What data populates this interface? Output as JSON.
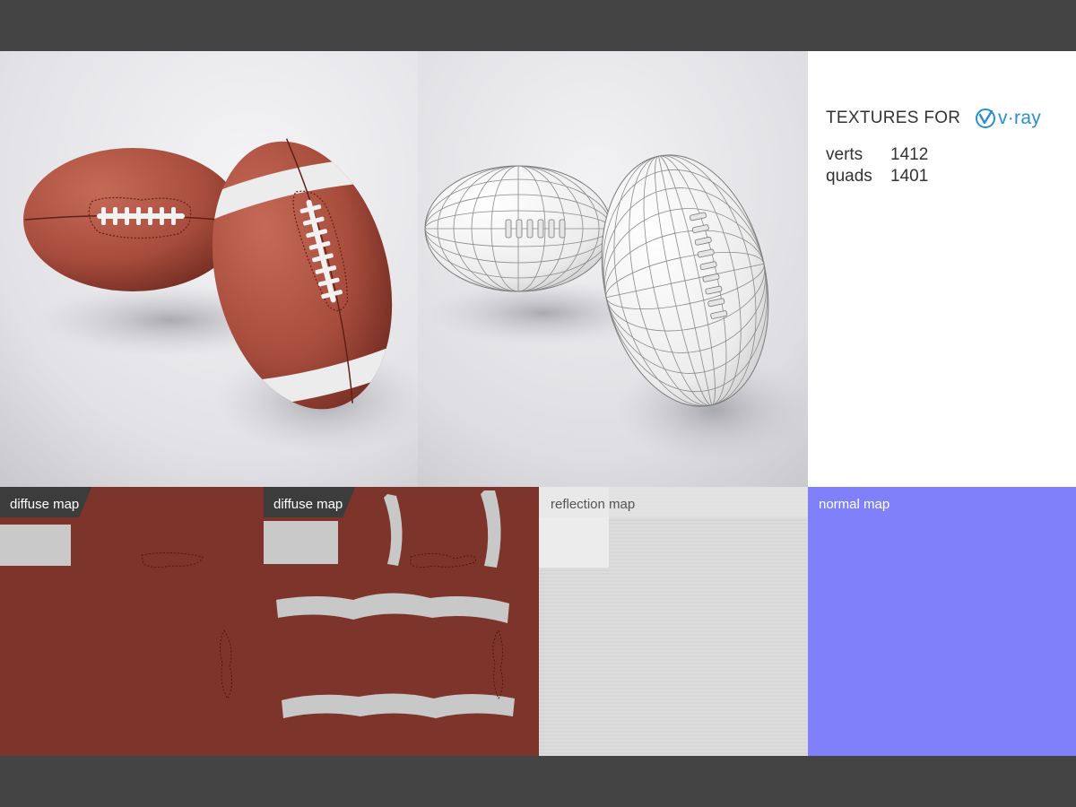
{
  "info": {
    "title": "TEXTURES FOR",
    "logo_text": "v·ray",
    "stats": [
      {
        "key": "verts",
        "value": "1412"
      },
      {
        "key": "quads",
        "value": "1401"
      }
    ]
  },
  "maps": [
    {
      "label": "diffuse map"
    },
    {
      "label": "diffuse map"
    },
    {
      "label": "reflection map"
    },
    {
      "label": "normal map"
    }
  ],
  "colors": {
    "frame": "#444444",
    "leather": "#a84d3d",
    "diffuse_bg": "#7d352b",
    "stripe": "#c8c8c8",
    "reflection_bg": "#e6e6e6",
    "normal_bg": "#8080fa",
    "vray_blue": "#2a8fd0"
  }
}
